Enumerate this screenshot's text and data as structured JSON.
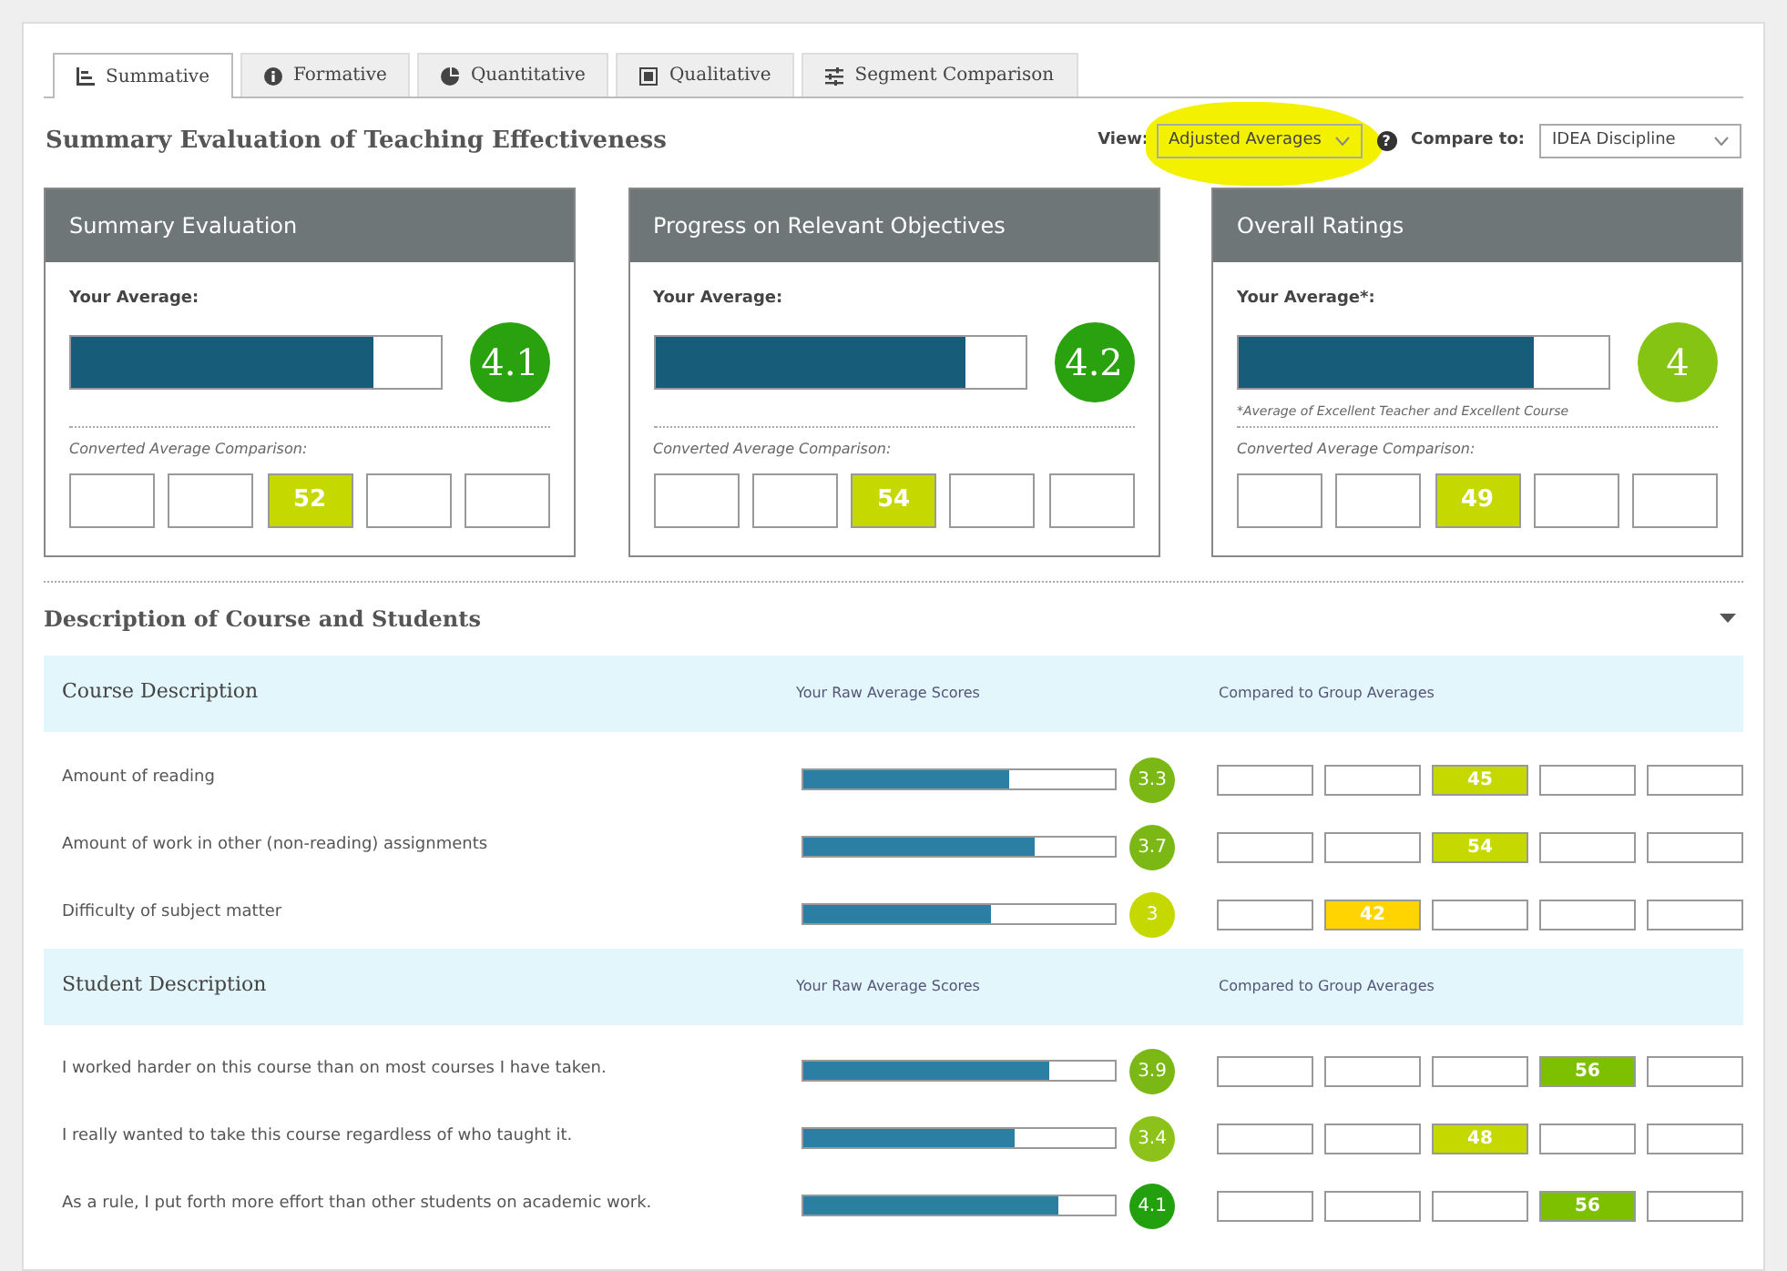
{
  "tabs": [
    {
      "label": "Summative",
      "selected": true
    },
    {
      "label": "Formative",
      "selected": false
    },
    {
      "label": "Quantitative",
      "selected": false
    },
    {
      "label": "Qualitative",
      "selected": false
    },
    {
      "label": "Segment Comparison",
      "selected": false
    }
  ],
  "title": "Summary Evaluation of Teaching Effectiveness",
  "view": {
    "label": "View:",
    "value": "Adjusted Averages",
    "highlighted": true,
    "help": "?"
  },
  "compare": {
    "label": "Compare to:",
    "value": "IDEA Discipline"
  },
  "cards": [
    {
      "title": "Summary Evaluation",
      "average_label": "Your Average:",
      "level": 0.82,
      "score": "4.1",
      "color": "#2aa10f",
      "comparison_label": "Converted Average Comparison:",
      "cells": [
        {
          "selected": false
        },
        {
          "selected": false
        },
        {
          "selected": true,
          "value": "52",
          "color": "#c5d800"
        },
        {
          "selected": false
        },
        {
          "selected": false
        }
      ]
    },
    {
      "title": "Progress on Relevant Objectives",
      "average_label": "Your Average:",
      "level": 0.84,
      "score": "4.2",
      "color": "#2aa10f",
      "comparison_label": "Converted Average Comparison:",
      "cells": [
        {
          "selected": false
        },
        {
          "selected": false
        },
        {
          "selected": true,
          "value": "54",
          "color": "#c5d800"
        },
        {
          "selected": false
        },
        {
          "selected": false
        }
      ]
    },
    {
      "title": "Overall Ratings",
      "average_label": "Your Average*:",
      "level": 0.8,
      "score": "4",
      "color": "#86c414",
      "note": "*Average of Excellent Teacher and Excellent Course",
      "comparison_label": "Converted Average Comparison:",
      "cells": [
        {
          "selected": false
        },
        {
          "selected": false
        },
        {
          "selected": true,
          "value": "49",
          "color": "#c5d800"
        },
        {
          "selected": false
        },
        {
          "selected": false
        }
      ]
    }
  ],
  "section": {
    "title": "Description of Course and Students",
    "expanded": true
  },
  "groups": [
    {
      "title": "Course Description",
      "scores_heading": "Your Raw Average Scores",
      "compare_heading": "Compared to Group Averages",
      "rows": [
        {
          "label": "Amount of reading",
          "level": 0.66,
          "score": "3.3",
          "color": "#7cb815",
          "cells": [
            {
              "selected": false
            },
            {
              "selected": false
            },
            {
              "selected": true,
              "value": "45",
              "color": "#c5d800"
            },
            {
              "selected": false
            },
            {
              "selected": false
            }
          ]
        },
        {
          "label": "Amount of work in other (non-reading) assignments",
          "level": 0.74,
          "score": "3.7",
          "color": "#7cb815",
          "cells": [
            {
              "selected": false
            },
            {
              "selected": false
            },
            {
              "selected": true,
              "value": "54",
              "color": "#c5d800"
            },
            {
              "selected": false
            },
            {
              "selected": false
            }
          ]
        },
        {
          "label": "Difficulty of subject matter",
          "level": 0.6,
          "score": "3",
          "color": "#c5d800",
          "cells": [
            {
              "selected": false
            },
            {
              "selected": true,
              "value": "42",
              "color": "#ffd400"
            },
            {
              "selected": false
            },
            {
              "selected": false
            },
            {
              "selected": false
            }
          ]
        }
      ]
    },
    {
      "title": "Student Description",
      "scores_heading": "Your Raw Average Scores",
      "compare_heading": "Compared to Group Averages",
      "rows": [
        {
          "label": "I worked harder on this course than on most courses I have taken.",
          "level": 0.79,
          "score": "3.9",
          "color": "#7cb815",
          "cells": [
            {
              "selected": false
            },
            {
              "selected": false
            },
            {
              "selected": false
            },
            {
              "selected": true,
              "value": "56",
              "color": "#7cc000"
            },
            {
              "selected": false
            }
          ]
        },
        {
          "label": "I really wanted to take this course regardless of who taught it.",
          "level": 0.68,
          "score": "3.4",
          "color": "#8cc21a",
          "cells": [
            {
              "selected": false
            },
            {
              "selected": false
            },
            {
              "selected": true,
              "value": "48",
              "color": "#c5d800"
            },
            {
              "selected": false
            },
            {
              "selected": false
            }
          ]
        },
        {
          "label": "As a rule, I put forth more effort than other students on academic work.",
          "level": 0.82,
          "score": "4.1",
          "color": "#22a00e",
          "cells": [
            {
              "selected": false
            },
            {
              "selected": false
            },
            {
              "selected": false
            },
            {
              "selected": true,
              "value": "56",
              "color": "#7cc000"
            },
            {
              "selected": false
            }
          ]
        }
      ]
    }
  ]
}
